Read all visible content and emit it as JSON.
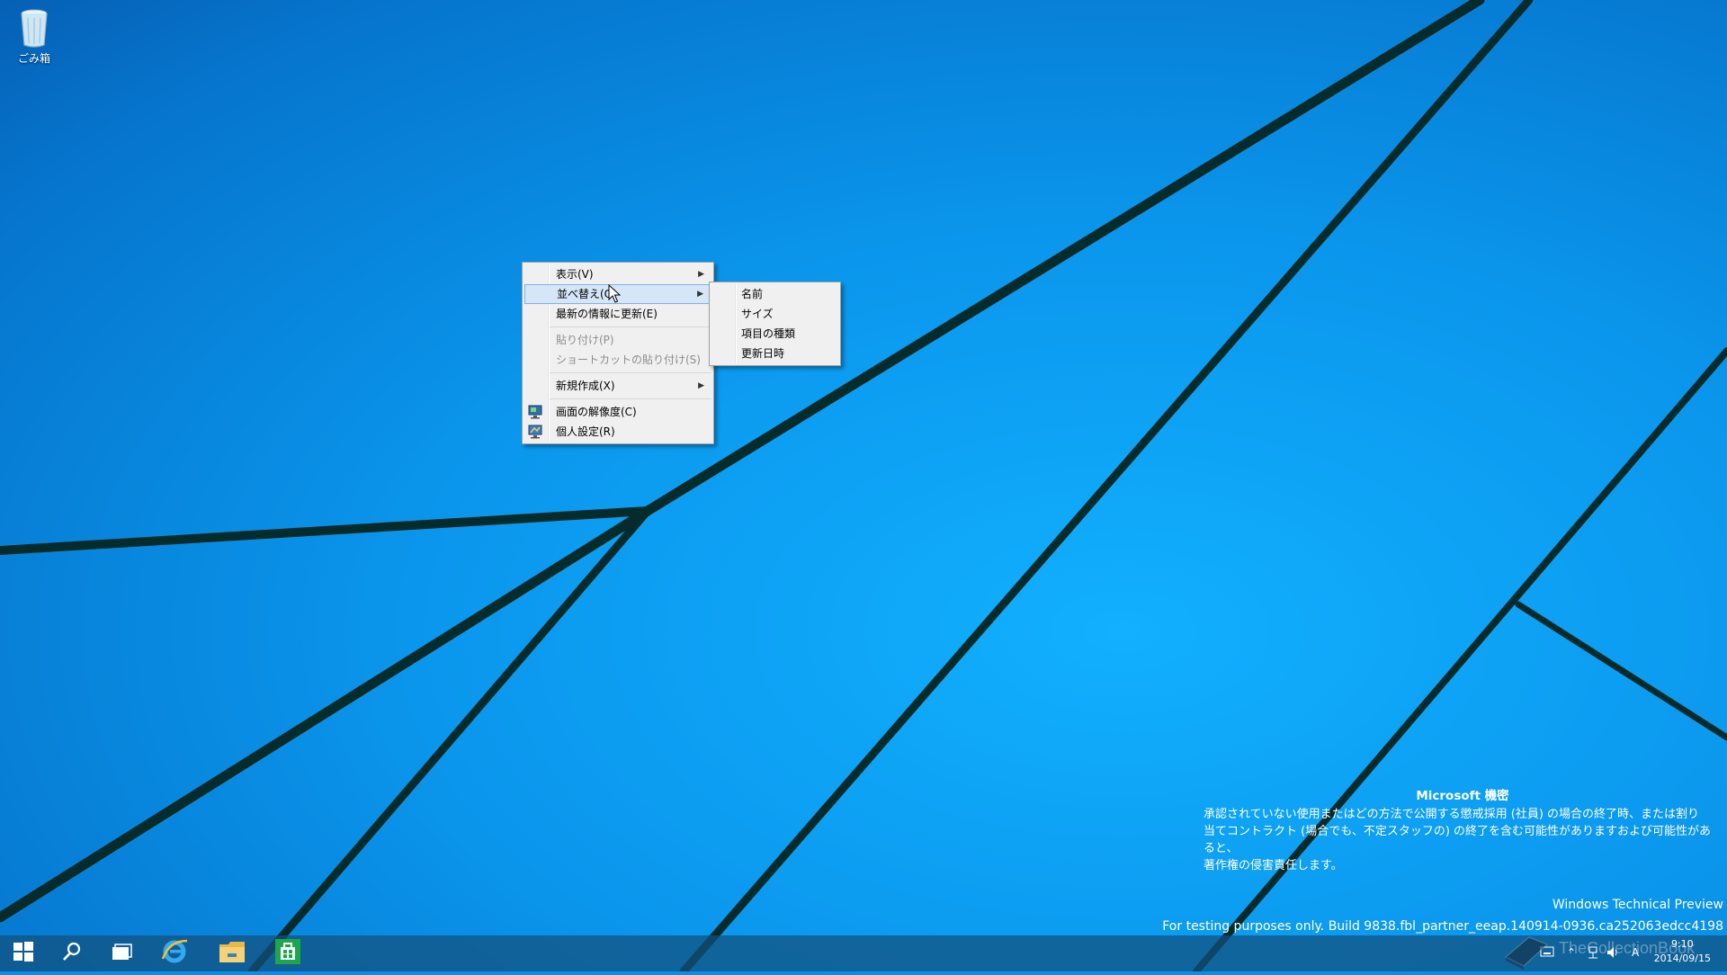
{
  "desktop": {
    "recycle_bin_label": "ごみ箱"
  },
  "context_menu": {
    "items": [
      {
        "label": "表示(V)",
        "submenu": true
      },
      {
        "label": "並べ替え(O)",
        "submenu": true,
        "selected": true
      },
      {
        "label": "最新の情報に更新(E)"
      },
      {
        "label": "貼り付け(P)",
        "disabled": true
      },
      {
        "label": "ショートカットの貼り付け(S)",
        "disabled": true
      },
      {
        "label": "新規作成(X)",
        "submenu": true
      },
      {
        "label": "画面の解像度(C)",
        "icon": "display-icon"
      },
      {
        "label": "個人設定(R)",
        "icon": "personalize-icon"
      }
    ]
  },
  "sort_submenu": {
    "items": [
      "名前",
      "サイズ",
      "項目の種類",
      "更新日時"
    ]
  },
  "watermark": {
    "title": "Microsoft 機密",
    "line1": "承認されていない使用またはどの方法で公開する懲戒採用 (社員) の場合の終了時、または割り",
    "line2": "当てコントラクト (場合でも、不定スタッフの) の終了を含む可能性がありますおよび可能性があると、",
    "line3": "著作権の侵害責任します。"
  },
  "build_info": {
    "product": "Windows Technical Preview",
    "build": "For testing purposes only. Build 9838.fbl_partner_eeap.140914-0936.ca252063edcc4198"
  },
  "taskbar": {
    "buttons": [
      "start-icon",
      "search-icon",
      "task-view-icon",
      "internet-explorer-icon",
      "file-explorer-icon",
      "store-icon"
    ],
    "tray_ime": "A",
    "clock_time": "9:10",
    "clock_date": "2014/09/15",
    "tray_watermark": "TheCollectionBook"
  },
  "colors": {
    "wallpaper": "#0a8ee6",
    "menu_bg": "#f0f0f0",
    "menu_selected": "#d5e6f8"
  }
}
